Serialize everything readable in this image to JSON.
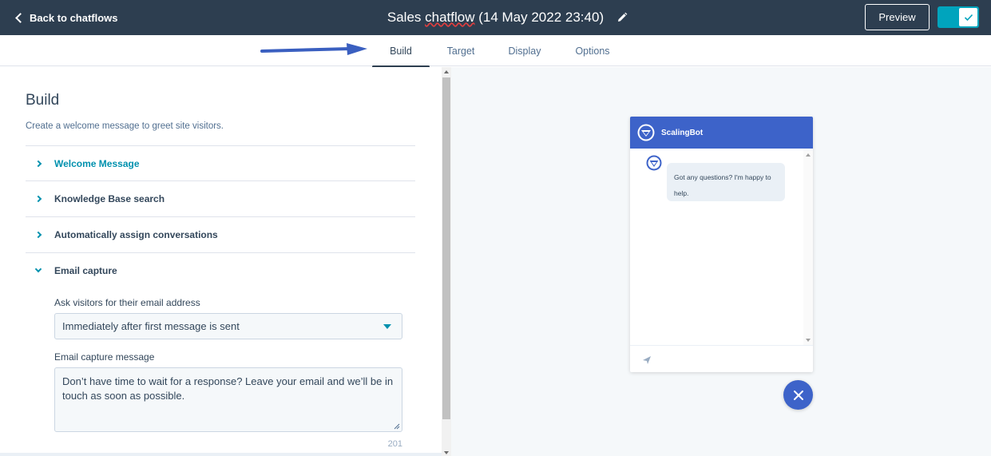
{
  "header": {
    "back_label": "Back to chatflows",
    "title_prefix": "Sales ",
    "title_underlined": "chatflow",
    "title_suffix": " (14 May 2022 23:40)",
    "preview_label": "Preview",
    "toggle_on": true
  },
  "tabs": [
    {
      "label": "Build",
      "active": true
    },
    {
      "label": "Target",
      "active": false
    },
    {
      "label": "Display",
      "active": false
    },
    {
      "label": "Options",
      "active": false
    }
  ],
  "build": {
    "heading": "Build",
    "subtitle": "Create a welcome message to greet site visitors.",
    "sections": [
      {
        "label": "Welcome Message",
        "expanded": false
      },
      {
        "label": "Knowledge Base search",
        "expanded": false
      },
      {
        "label": "Automatically assign conversations",
        "expanded": false
      },
      {
        "label": "Email capture",
        "expanded": true
      }
    ],
    "email_capture": {
      "ask_label": "Ask visitors for their email address",
      "ask_value": "Immediately after first message is sent",
      "message_label": "Email capture message",
      "message_value": "Don’t have time to wait for a response? Leave your email and we’ll be in touch as soon as possible.",
      "char_count": "201"
    }
  },
  "preview": {
    "bot_name": "ScalingBot",
    "bot_message": "Got any questions? I'm happy to help."
  },
  "colors": {
    "topbar": "#2d3e50",
    "accent": "#0091ae",
    "widget_brand": "#3d63c9",
    "toggle": "#00a4bd",
    "annotation_arrow": "#3a5fc0"
  }
}
